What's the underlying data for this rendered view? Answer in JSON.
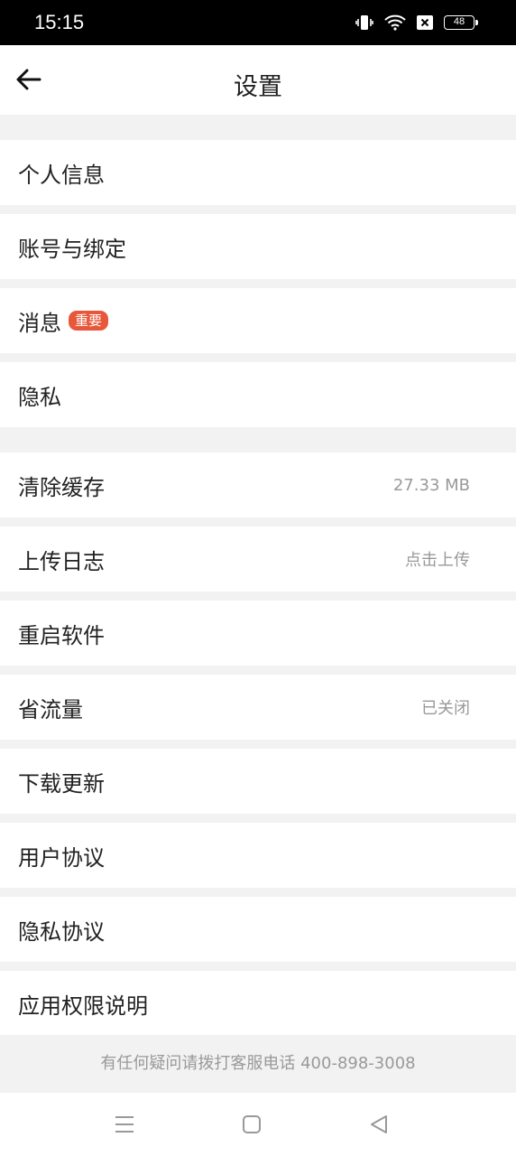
{
  "status_bar": {
    "time": "15:15",
    "battery": "48"
  },
  "header": {
    "title": "设置",
    "back_icon": "arrow-left-icon"
  },
  "menu_items": [
    {
      "label": "个人信息"
    },
    {
      "label": "账号与绑定"
    },
    {
      "label": "消息",
      "badge": "重要"
    },
    {
      "label": "隐私"
    },
    {
      "label": "清除缓存",
      "value": "27.33 MB"
    },
    {
      "label": "上传日志",
      "value": "点击上传"
    },
    {
      "label": "重启软件"
    },
    {
      "label": "省流量",
      "value": "已关闭"
    },
    {
      "label": "下载更新"
    },
    {
      "label": "用户协议"
    },
    {
      "label": "隐私协议"
    },
    {
      "label": "应用权限说明"
    }
  ],
  "footer": {
    "text": "有任何疑问请拨打客服电话 400-898-3008"
  },
  "colors": {
    "badge": "#e8573a",
    "value_text": "#999999",
    "divider": "#f2f2f2"
  }
}
